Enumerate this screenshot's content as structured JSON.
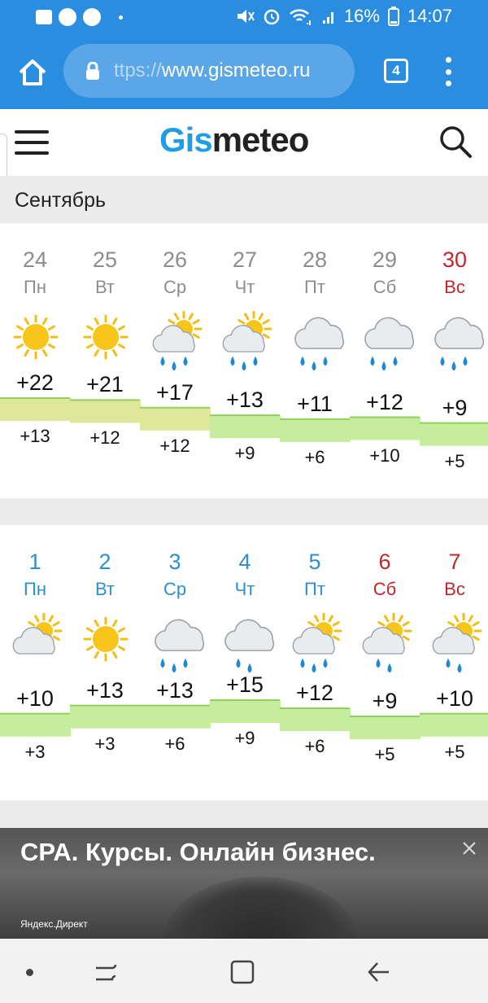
{
  "status": {
    "battery": "16%",
    "time": "14:07"
  },
  "browser": {
    "url_dim": "ttps://",
    "url_main": "www.gismeteo.ru",
    "tab_count": "4"
  },
  "app": {
    "logo_part1": "Gis",
    "logo_part2": "meteo"
  },
  "month": "Сентябрь",
  "weeks": [
    {
      "days": [
        {
          "num": "24",
          "name": "Пн",
          "icon": "sun-icon",
          "tmax": "+22",
          "tmin": "+13",
          "max": 22,
          "min": 13,
          "weekend": false
        },
        {
          "num": "25",
          "name": "Вт",
          "icon": "sun-icon",
          "tmax": "+21",
          "tmin": "+12",
          "max": 21,
          "min": 12,
          "weekend": false
        },
        {
          "num": "26",
          "name": "Ср",
          "icon": "sun-cloud-rain-icon",
          "tmax": "+17",
          "tmin": "+12",
          "max": 17,
          "min": 12,
          "weekend": false
        },
        {
          "num": "27",
          "name": "Чт",
          "icon": "sun-cloud-rain-icon",
          "tmax": "+13",
          "tmin": "+9",
          "max": 13,
          "min": 9,
          "weekend": false
        },
        {
          "num": "28",
          "name": "Пт",
          "icon": "cloud-rain-icon",
          "tmax": "+11",
          "tmin": "+6",
          "max": 11,
          "min": 6,
          "weekend": false
        },
        {
          "num": "29",
          "name": "Сб",
          "icon": "cloud-rain-icon",
          "tmax": "+12",
          "tmin": "+10",
          "max": 12,
          "min": 10,
          "weekend": false
        },
        {
          "num": "30",
          "name": "Вс",
          "icon": "cloud-rain-icon",
          "tmax": "+9",
          "tmin": "+5",
          "max": 9,
          "min": 5,
          "weekend": true
        }
      ]
    },
    {
      "days": [
        {
          "num": "1",
          "name": "Пн",
          "icon": "sun-cloud-icon",
          "tmax": "+10",
          "tmin": "+3",
          "max": 10,
          "min": 3,
          "weekend": false
        },
        {
          "num": "2",
          "name": "Вт",
          "icon": "sun-icon",
          "tmax": "+13",
          "tmin": "+3",
          "max": 13,
          "min": 3,
          "weekend": false
        },
        {
          "num": "3",
          "name": "Ср",
          "icon": "cloud-rain-icon",
          "tmax": "+13",
          "tmin": "+6",
          "max": 13,
          "min": 6,
          "weekend": false
        },
        {
          "num": "4",
          "name": "Чт",
          "icon": "cloud-light-rain-icon",
          "tmax": "+15",
          "tmin": "+9",
          "max": 15,
          "min": 9,
          "weekend": false
        },
        {
          "num": "5",
          "name": "Пт",
          "icon": "sun-cloud-rain-icon",
          "tmax": "+12",
          "tmin": "+6",
          "max": 12,
          "min": 6,
          "weekend": false
        },
        {
          "num": "6",
          "name": "Сб",
          "icon": "sun-cloud-light-rain-icon",
          "tmax": "+9",
          "tmin": "+5",
          "max": 9,
          "min": 5,
          "weekend": true
        },
        {
          "num": "7",
          "name": "Вс",
          "icon": "sun-cloud-light-rain-icon",
          "tmax": "+10",
          "tmin": "+5",
          "max": 10,
          "min": 5,
          "weekend": true
        }
      ]
    }
  ],
  "ad": {
    "headline": "СРА. Курсы. Онлайн бизнес.",
    "source": "Яндекс.Директ"
  },
  "colors": {
    "accent": "#2b8de0",
    "logo_blue": "#1f9ee6",
    "weekend": "#c2272d",
    "weekday_blue": "#2f8ecf",
    "temp_band_warm": "#dfe89a",
    "temp_band_cool": "#c6ec9e"
  }
}
